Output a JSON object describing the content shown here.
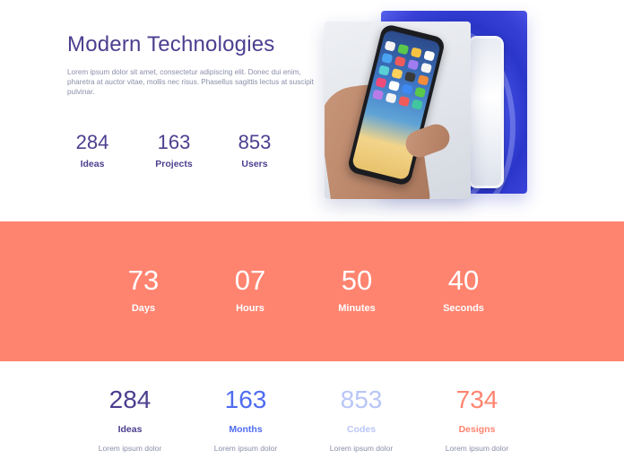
{
  "hero": {
    "title": "Modern Technologies",
    "description": "Lorem ipsum dolor sit amet, consectetur adipiscing elit. Donec dui enim, pharetra at auctor vitae, mollis nec risus. Phasellus sagittis lectus at suscipit pulvinar.",
    "stats": [
      {
        "value": "284",
        "label": "Ideas"
      },
      {
        "value": "163",
        "label": "Projects"
      },
      {
        "value": "853",
        "label": "Users"
      }
    ]
  },
  "countdown": {
    "background_color": "#ff8470",
    "items": [
      {
        "value": "73",
        "label": "Days"
      },
      {
        "value": "07",
        "label": "Hours"
      },
      {
        "value": "50",
        "label": "Minutes"
      },
      {
        "value": "40",
        "label": "Seconds"
      }
    ]
  },
  "bottom_stats": [
    {
      "value": "284",
      "label": "Ideas",
      "sub": "Lorem ipsum dolor",
      "color": "#4b3f8f"
    },
    {
      "value": "163",
      "label": "Months",
      "sub": "Lorem ipsum dolor",
      "color": "#4f6cf0"
    },
    {
      "value": "853",
      "label": "Codes",
      "sub": "Lorem ipsum dolor",
      "color": "#b9c6f7"
    },
    {
      "value": "734",
      "label": "Designs",
      "sub": "Lorem ipsum dolor",
      "color": "#ff8470"
    }
  ]
}
